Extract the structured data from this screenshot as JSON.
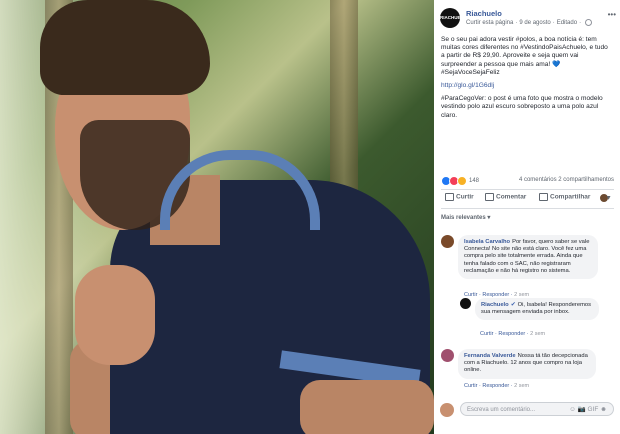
{
  "photo": {
    "subject": "man-in-navy-polo"
  },
  "post": {
    "page_name": "Riachuelo",
    "logo_text": "RIACHUELO",
    "meta_follow": "Curtir esta página",
    "meta_date": "9 de agosto",
    "meta_edit": "Editado",
    "body_1": "Se o seu pai adora vestir #polos, a boa notícia é: tem muitas cores diferentes no #VestindoPaisAchuelo, e tudo a partir de R$ 29,90. Aproveite e seja quem vai surpreender a pessoa que mais ama! 💙 #SejaVoceSejaFeliz",
    "link": "http://glo.gl/1G6dlj",
    "body_3": "#ParaCegoVer: o post é uma foto que mostra o modelo vestindo polo azul escuro sobreposto a uma polo azul claro.",
    "reactions_count": "148",
    "comments_count": "4 comentários",
    "shares_count": "2 compartilhamentos",
    "actions": {
      "like": "Curtir",
      "comment": "Comentar",
      "share": "Compartilhar"
    },
    "relevance": "Mais relevantes ▾"
  },
  "comments": [
    {
      "author": "Isabela Carvalho",
      "text": "Por favor, quero saber se vale Connecta! No site não está claro. Você fez uma compra pelo site totalmente errada. Ainda que tenha falado com o SAC, não registraram reclamação e não há registro no sistema.",
      "like": "Curtir",
      "reply": "Responder",
      "time": "2 sem"
    },
    {
      "author": "Riachuelo",
      "verified": "✔",
      "text": "Oi, Isabela! Responderemos sua mensagem enviada por inbox.",
      "like": "Curtir",
      "reply": "Responder",
      "time": "2 sem"
    },
    {
      "author": "Fernanda Valverde",
      "text": "Nossa tá tão decepcionada com a Riachuelo. 12 anos que compro na loja online.",
      "like": "Curtir",
      "reply": "Responder",
      "time": "2 sem"
    }
  ],
  "composer": {
    "placeholder": "Escreva um comentário...",
    "icons": "☺ 📷 GIF ☻"
  },
  "colors": {
    "link": "#385898",
    "bubble": "#f2f3f5",
    "shirt": "#1d2640",
    "collar": "#5b7fb6"
  }
}
